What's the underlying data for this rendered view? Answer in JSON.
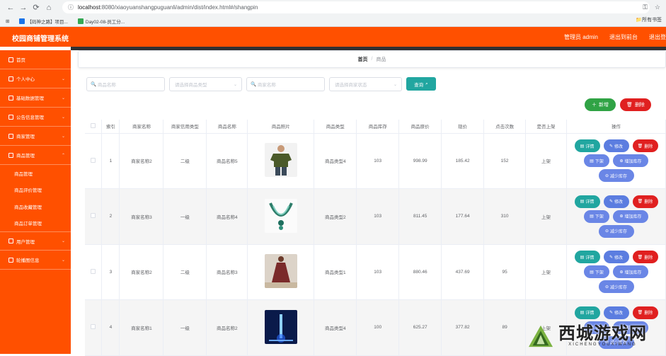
{
  "browser": {
    "url_host": "localhost",
    "url_path": ":8080/xiaoyuanshangpuguanli/admin/dist/index.html#/shangpin",
    "bookmarks": [
      "【码神之路】项目...",
      "Day02-08-员工分..."
    ],
    "all_bookmarks": "所有书签"
  },
  "app": {
    "title": "校园商铺管理系统",
    "admin_label": "管理员 admin",
    "back_label": "退出到前台",
    "logout_label": "退出登"
  },
  "sidebar": {
    "items": [
      {
        "label": "首页",
        "icon": "home-icon"
      },
      {
        "label": "个人中心",
        "icon": "user-icon"
      },
      {
        "label": "基础数据管理",
        "icon": "data-icon"
      },
      {
        "label": "公告信息管理",
        "icon": "notice-icon"
      },
      {
        "label": "商家管理",
        "icon": "shop-icon"
      },
      {
        "label": "商品管理",
        "icon": "goods-icon"
      }
    ],
    "subitems": [
      "商品管理",
      "商品评价管理",
      "商品收藏管理",
      "商品订单管理"
    ],
    "tail_items": [
      {
        "label": "用户管理",
        "icon": "users-icon"
      },
      {
        "label": "轮播图信息",
        "icon": "carousel-icon"
      }
    ]
  },
  "breadcrumb": {
    "home": "首页",
    "sep": "/",
    "current": "商品"
  },
  "filters": {
    "name_placeholder": "商品名称",
    "type_placeholder": "请选择商品类型",
    "shop_placeholder": "商家名称",
    "status_placeholder": "请选择商家状态",
    "search_label": "查询"
  },
  "actions": {
    "add_label": "新增",
    "delete_label": "删除"
  },
  "table": {
    "headers": [
      "索引",
      "商家名称",
      "商家信用类型",
      "商品名称",
      "商品照片",
      "商品类型",
      "商品库存",
      "商品原价",
      "现价",
      "点击次数",
      "是否上架",
      "操作"
    ],
    "rows": [
      {
        "index": "1",
        "shop": "商家名称2",
        "credit": "二级",
        "name": "商品名称5",
        "photo": "tshirt",
        "type": "商品类型4",
        "stock": "103",
        "orig": "998.99",
        "price": "185.42",
        "clicks": "152",
        "shelf": "上架"
      },
      {
        "index": "2",
        "shop": "商家名称3",
        "credit": "一级",
        "name": "商品名称4",
        "photo": "necklace",
        "type": "商品类型2",
        "stock": "103",
        "orig": "811.45",
        "price": "177.64",
        "clicks": "310",
        "shelf": "上架"
      },
      {
        "index": "3",
        "shop": "商家名称2",
        "credit": "二级",
        "name": "商品名称3",
        "photo": "dress",
        "type": "商品类型1",
        "stock": "103",
        "orig": "880.46",
        "price": "437.69",
        "clicks": "95",
        "shelf": "上架"
      },
      {
        "index": "4",
        "shop": "商家名称1",
        "credit": "一级",
        "name": "商品名称2",
        "photo": "poster",
        "type": "商品类型4",
        "stock": "100",
        "orig": "625.27",
        "price": "377.82",
        "clicks": "89",
        "shelf": "上架"
      }
    ],
    "ops": {
      "detail": "详情",
      "edit": "修改",
      "delete": "删除",
      "off": "下架",
      "add_stock": "增加库存",
      "reduce_stock": "减少库存"
    }
  },
  "watermark": {
    "title": "西城游戏网",
    "sub": "XICHENGYOUXIWANG"
  }
}
